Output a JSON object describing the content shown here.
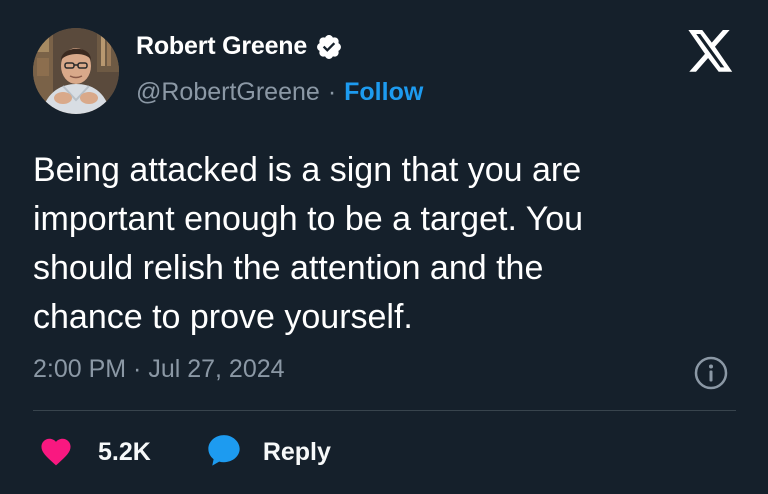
{
  "author": {
    "display_name": "Robert Greene",
    "handle": "@RobertGreene",
    "verified": true,
    "avatar_icon": "portrait-avatar"
  },
  "follow_label": "Follow",
  "separator": "·",
  "tweet": {
    "text": "Being attacked is a sign that you are\nimportant enough to be a target. You\nshould relish the attention and the\nchance to prove yourself.",
    "timestamp": "2:00 PM · Jul 27, 2024"
  },
  "actions": {
    "like_count": "5.2K",
    "reply_label": "Reply"
  },
  "icons": {
    "logo": "x-logo-icon",
    "verified": "verified-badge-icon",
    "info": "info-icon",
    "like": "heart-icon",
    "reply": "speech-bubble-icon"
  },
  "colors": {
    "background": "#15202b",
    "accent": "#1d9bf0",
    "like": "#f91880",
    "secondary_text": "#8b98a5",
    "divider": "#38444d"
  }
}
